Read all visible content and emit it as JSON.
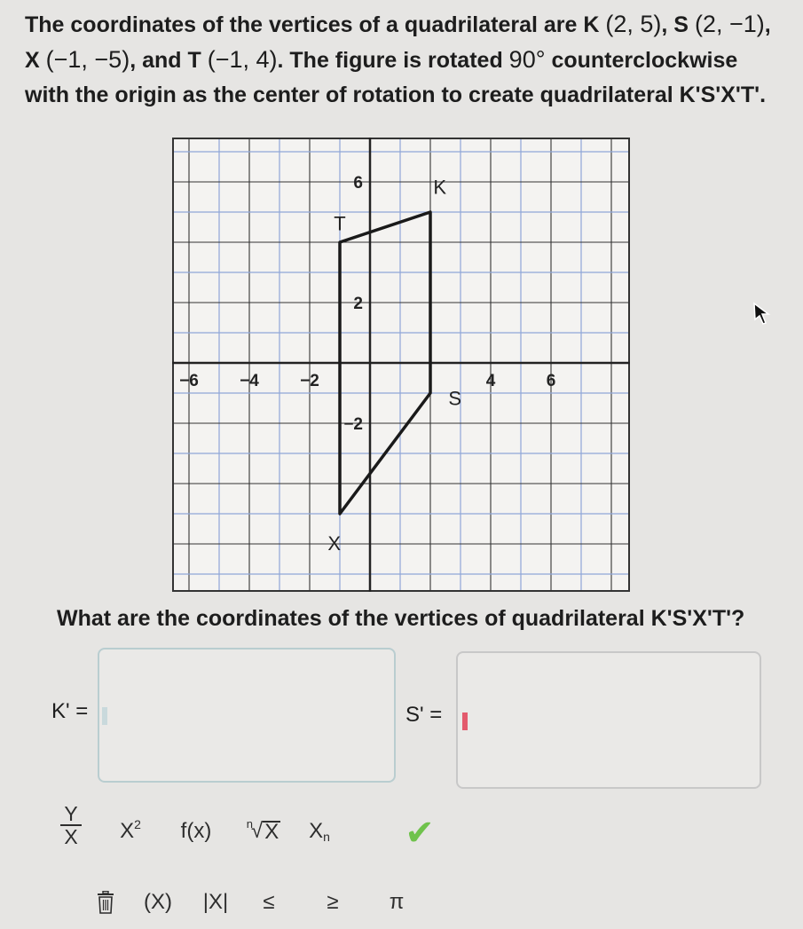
{
  "question": {
    "part1": "The coordinates of the vertices of a quadrilateral are K",
    "k": "(2, 5)",
    "sep1": ", S",
    "s": "(2, −1)",
    "sep2": ",",
    "x_label": "X",
    "x": "(−1, −5)",
    "sep3": ", and T",
    "t": "(−1, 4)",
    "part2": ". The figure is rotated",
    "angle": "90°",
    "part3": "counterclockwise with the origin as the center of rotation to create quadrilateral K'S'X'T'."
  },
  "graph": {
    "x_ticks": [
      "−6",
      "−4",
      "−2",
      "4",
      "6"
    ],
    "y_ticks": [
      "6",
      "2",
      "−2"
    ],
    "vertex_labels": {
      "k": "K",
      "s": "S",
      "x": "X",
      "t": "T"
    },
    "colors": {
      "minor_grid": "#8fa6d8",
      "axis": "#222222",
      "border": "#333333",
      "shape": "#1a1a1a"
    }
  },
  "prompt": "What are the coordinates of the vertices of quadrilateral K'S'X'T'?",
  "answers": {
    "k_label": "K' =",
    "k_value": "",
    "s_label": "S' =",
    "s_value": ""
  },
  "toolbar": {
    "fraction_num": "Y",
    "fraction_den": "X",
    "power_base": "X",
    "power_exp": "2",
    "function": "f(x)",
    "root_index": "n",
    "root_radicand": "X",
    "subscript_base": "X",
    "subscript_idx": "n",
    "check": "✔",
    "parens": "(X)",
    "abs": "|X|",
    "le": "≤",
    "ge": "≥",
    "pi": "π"
  },
  "icons": {
    "trash": "trash-icon",
    "check": "checkmark-icon",
    "cursor": "mouse-pointer-icon"
  }
}
